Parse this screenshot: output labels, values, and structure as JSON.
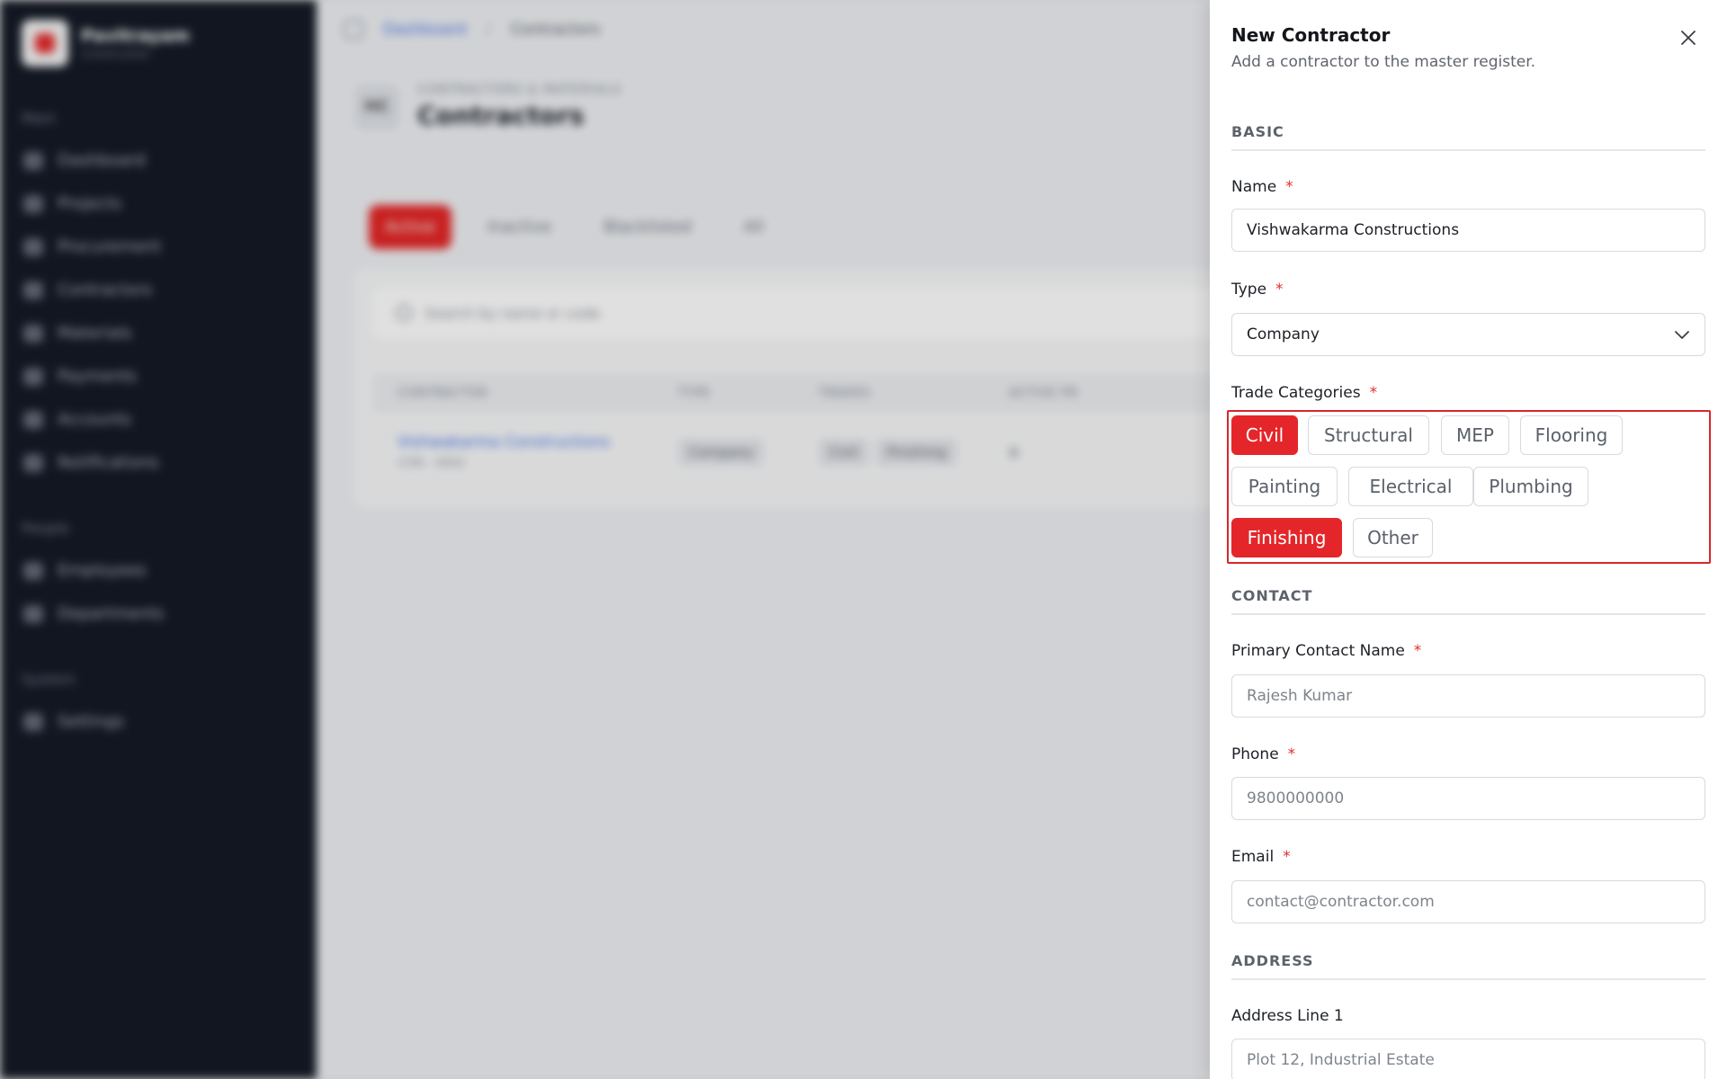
{
  "sidebar": {
    "brand_name": "Pavitrayam",
    "brand_sub": "Construction",
    "groups": {
      "main": "Main",
      "people": "People",
      "system": "System"
    },
    "items": [
      {
        "label": "Dashboard",
        "icon": "dashboard-icon"
      },
      {
        "label": "Projects",
        "icon": "folder-icon"
      },
      {
        "label": "Procurement",
        "icon": "cart-icon"
      },
      {
        "label": "Contractors",
        "icon": "users-icon"
      },
      {
        "label": "Materials",
        "icon": "box-icon"
      },
      {
        "label": "Payments",
        "icon": "card-icon"
      },
      {
        "label": "Accounts",
        "icon": "ledger-icon"
      },
      {
        "label": "Notifications",
        "icon": "bell-icon"
      },
      {
        "label": "Employees",
        "icon": "people-icon"
      },
      {
        "label": "Departments",
        "icon": "building-icon"
      },
      {
        "label": "Settings",
        "icon": "gear-icon"
      }
    ]
  },
  "topbar": {
    "breadcrumb_root": "Dashboard",
    "breadcrumb_sep": "/",
    "breadcrumb_current": "Contractors"
  },
  "page": {
    "eyebrow": "CONTRACTORS & MATERIALS",
    "title": "Contractors",
    "icon_text": "HC"
  },
  "tabs": [
    "Active",
    "Inactive",
    "Blacklisted",
    "All"
  ],
  "list": {
    "search_placeholder": "Search by name or code",
    "columns": [
      "CONTRACTOR",
      "TYPE",
      "TRADES",
      "ACTIVE PR"
    ],
    "rows": [
      {
        "name": "Vishwakarma Constructions",
        "code": "CON - 0002",
        "type": "Company",
        "trades": [
          "Civil",
          "Finishing"
        ],
        "count": "0"
      }
    ]
  },
  "drawer": {
    "title": "New Contractor",
    "subtitle": "Add a contractor to the master register.",
    "sections": {
      "basic": "BASIC",
      "contact": "CONTACT",
      "address": "ADDRESS"
    },
    "required_mark": "*",
    "fields": {
      "name": {
        "label": "Name",
        "value": "Vishwakarma Constructions"
      },
      "type": {
        "label": "Type",
        "value": "Company"
      },
      "trades": {
        "label": "Trade Categories"
      },
      "contact_name": {
        "label": "Primary Contact Name",
        "placeholder": "Rajesh Kumar"
      },
      "phone": {
        "label": "Phone",
        "placeholder": "9800000000"
      },
      "email": {
        "label": "Email",
        "placeholder": "contact@contractor.com"
      },
      "address1": {
        "label": "Address Line 1",
        "placeholder": "Plot 12, Industrial Estate"
      }
    },
    "trade_chips": [
      {
        "label": "Civil",
        "selected": true
      },
      {
        "label": "Structural",
        "selected": false
      },
      {
        "label": "MEP",
        "selected": false
      },
      {
        "label": "Flooring",
        "selected": false
      },
      {
        "label": "Painting",
        "selected": false
      },
      {
        "label": "Electrical",
        "selected": false
      },
      {
        "label": "Plumbing",
        "selected": false
      },
      {
        "label": "Finishing",
        "selected": true
      },
      {
        "label": "Other",
        "selected": false
      }
    ]
  },
  "colors": {
    "accent": "#e4262a",
    "sidebar_bg": "#141a26",
    "link": "#3f6ee0"
  }
}
